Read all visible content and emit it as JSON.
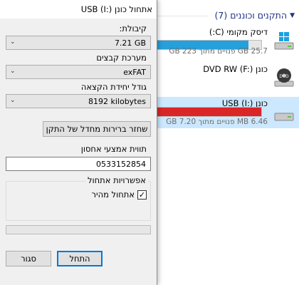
{
  "explorer": {
    "section_title": "התקנים וכוננים (7)",
    "drives": [
      {
        "name": "דיסק מקומי (C:)",
        "icon": "windows-drive-icon",
        "space": "25.7 GB פנויים מתוך 223 GB",
        "used_fraction": 0.88,
        "bar_color": "#26a0da"
      },
      {
        "name": "כונן DVD RW (F:)",
        "icon": "dvd-drive-icon",
        "space": "",
        "used_fraction": null,
        "bar_color": ""
      },
      {
        "name": "כונן USB (I:)",
        "icon": "usb-drive-icon",
        "space": "6.46 MB פנויים מתוך 7.20 GB",
        "used_fraction": 0.999,
        "bar_color": "#da2626"
      }
    ]
  },
  "dialog": {
    "title": "אתחול כונן USB (I:)",
    "capacity_label": "קיבולת:",
    "capacity_value": "7.21 GB",
    "filesystem_label": "מערכת קבצים",
    "filesystem_value": "exFAT",
    "allocation_label": "גודל יחידת הקצאה",
    "allocation_value": "8192 kilobytes",
    "restore_defaults_label": "שחזר ברירות מחדל של התקן",
    "volume_label_label": "תווית אמצעי אחסון",
    "volume_label_value": "0533152854",
    "format_options_label": "אפשרויות אתחול",
    "quick_format_label": "אתחול מהיר",
    "quick_format_checked": "✓",
    "start_label": "התחל",
    "close_label": "סגור",
    "progress_fraction": 0,
    "accent_color": "#0078d7"
  }
}
